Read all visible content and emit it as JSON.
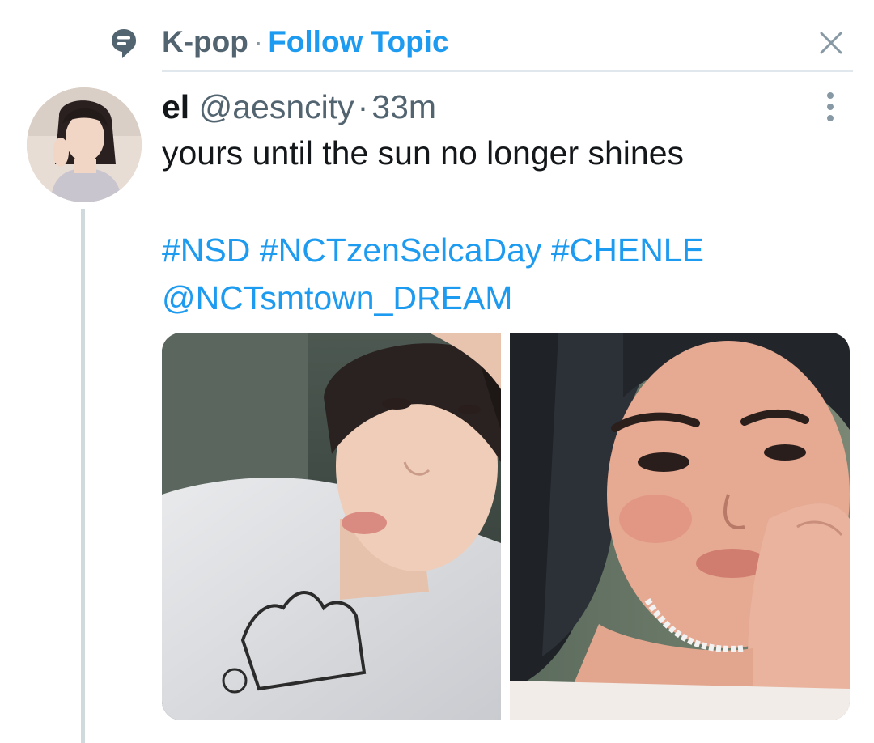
{
  "topic": {
    "name": "K-pop",
    "separator": "·",
    "follow_label": "Follow Topic",
    "icon": "topic-bubble-icon",
    "close_icon": "close-icon"
  },
  "tweet": {
    "display_name": "el",
    "handle": "@aesncity",
    "separator": "·",
    "timestamp": "33m",
    "text": "yours until the sun no longer shines",
    "hashtags": [
      "#NSD",
      "#NCTzenSelcaDay",
      "#CHENLE"
    ],
    "mention": "@NCTsmtown_DREAM",
    "more_icon": "more-vertical-icon",
    "media": [
      {
        "kind": "photo",
        "icon": "selfie-photo-1"
      },
      {
        "kind": "photo",
        "icon": "selfie-photo-2"
      }
    ]
  },
  "colors": {
    "accent": "#1d9bf0",
    "muted": "#536471",
    "text": "#14171a",
    "divider": "#e1e8ed",
    "thread_line": "#cfd9de"
  }
}
